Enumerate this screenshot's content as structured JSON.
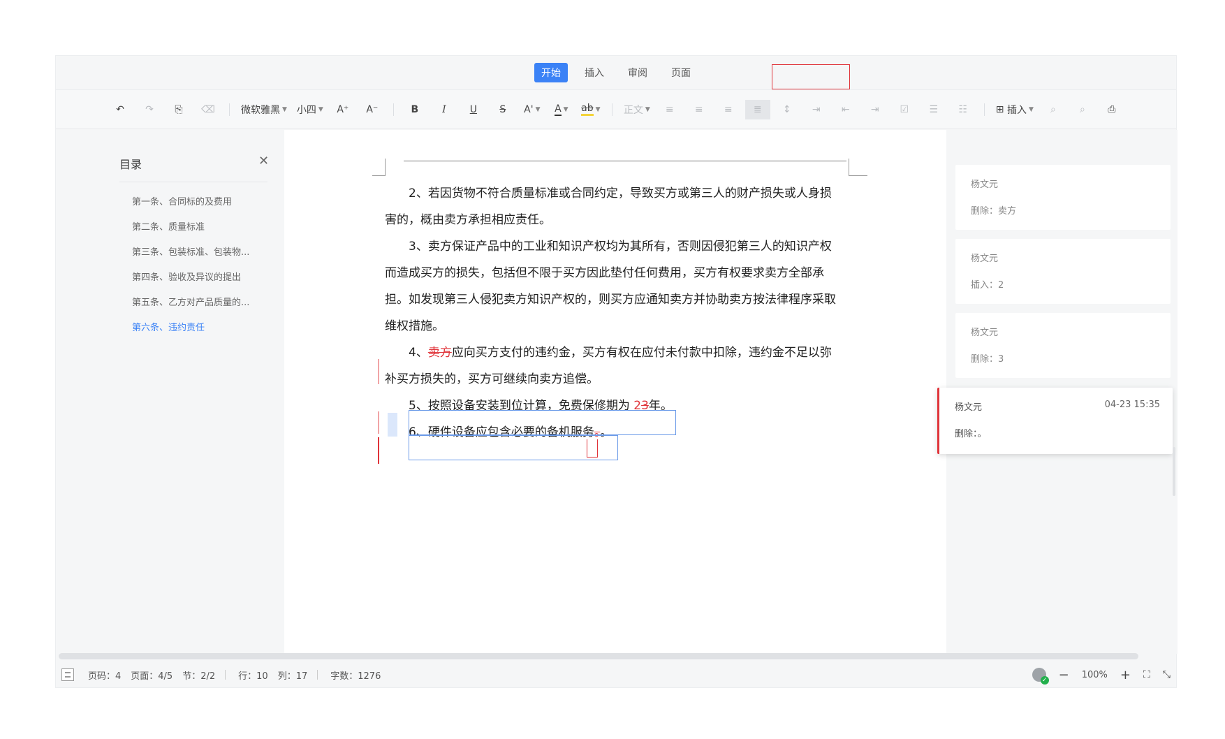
{
  "tabs": [
    {
      "label": "开始",
      "active": true
    },
    {
      "label": "插入",
      "active": false
    },
    {
      "label": "审阅",
      "active": false
    },
    {
      "label": "页面",
      "active": false
    }
  ],
  "toolbar": {
    "undo_icon": "↶",
    "redo_icon": "↷",
    "format_painter_icon": "⎘",
    "clear_format_icon": "⌫",
    "font_family": "微软雅黑",
    "font_size": "小四",
    "grow_font": "A⁺",
    "shrink_font": "A⁻",
    "bold": "B",
    "italic": "I",
    "underline": "U",
    "strikethrough": "S",
    "superscript": "A'",
    "font_color": "A",
    "highlight": "ab",
    "style": "正文",
    "align_left_icon": "≡",
    "align_center_icon": "≡",
    "align_right_icon": "≡",
    "justify_icon": "≣",
    "line_spacing_icon": "↕",
    "indent_icon": "⇥",
    "outdent_icon": "⇤",
    "indent2_icon": "⇥",
    "checkbox_icon": "☑",
    "bullet_list_icon": "☰",
    "number_list_icon": "☷",
    "insert_icon": "⊞",
    "insert_label": "插入",
    "find_icon": "⌕",
    "zoom_icon": "⌕",
    "print_icon": "⎙"
  },
  "sidebar": {
    "title": "目录",
    "close": "✕",
    "items": [
      {
        "label": "第一条、合同标的及费用",
        "active": false
      },
      {
        "label": "第二条、质量标准",
        "active": false
      },
      {
        "label": "第三条、包装标准、包装物...",
        "active": false
      },
      {
        "label": "第四条、验收及异议的提出",
        "active": false
      },
      {
        "label": "第五条、乙方对产品质量的...",
        "active": false
      },
      {
        "label": "第六条、违约责任",
        "active": true
      }
    ]
  },
  "document": {
    "p2": "2、若因货物不符合质量标准或合同约定，导致买方或第三人的财产损失或人身损害的，概由卖方承担相应责任。",
    "p3": "3、卖方保证产品中的工业和知识产权均为其所有，否则因侵犯第三人的知识产权而造成买方的损失，包括但不限于买方因此垫付任何费用，买方有权要求卖方全部承担。如发现第三人侵犯卖方知识产权的，则买方应通知卖方并协助卖方按法律程序采取维权措施。",
    "p4_prefix": "4、",
    "p4_deleted": "卖方",
    "p4_rest": "应向买方支付的违约金，买方有权在应付未付款中扣除，违约金不足以弥补买方损失的，买方可继续向卖方追偿。",
    "p5_prefix": "5、按照设备安装到位计算，免费保修期为 ",
    "p5_inserted": "2",
    "p5_deleted": "3",
    "p5_suffix": "年。",
    "p6_prefix": "6、硬件设备应包含必要的备机服务",
    "p6_deleted": "。",
    "p6_suffix": "。"
  },
  "comments": [
    {
      "author": "杨文元",
      "content": "删除：卖方",
      "time": "",
      "active": false
    },
    {
      "author": "杨文元",
      "content": "插入：2",
      "time": "",
      "active": false
    },
    {
      "author": "杨文元",
      "content": "删除：3",
      "time": "",
      "active": false
    },
    {
      "author": "杨文元",
      "content": "删除：。",
      "time": "04-23 15:35",
      "active": true
    }
  ],
  "status": {
    "page_num": "页码：4",
    "pages": "页面：4/5",
    "section": "节：2/2",
    "row": "行：10",
    "col": "列：17",
    "words": "字数：1276",
    "zoom": "100%",
    "zoom_out": "−",
    "zoom_in": "+",
    "fit_icon": "⛶",
    "collapse_icon": "⤡"
  },
  "colors": {
    "accent": "#3b82f6",
    "revision": "#e0343a"
  }
}
